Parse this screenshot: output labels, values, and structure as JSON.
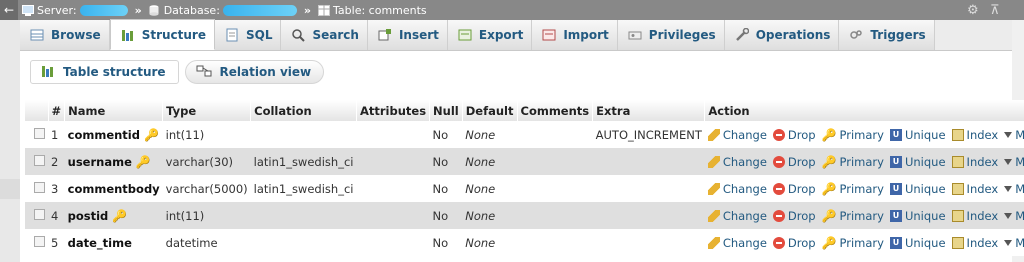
{
  "breadcrumb": {
    "server_label": "Server:",
    "database_label": "Database:",
    "table_label": "Table: comments"
  },
  "tabs": [
    {
      "label": "Browse",
      "icon": "browse-icon",
      "active": false
    },
    {
      "label": "Structure",
      "icon": "structure-icon",
      "active": true
    },
    {
      "label": "SQL",
      "icon": "sql-icon",
      "active": false
    },
    {
      "label": "Search",
      "icon": "search-icon",
      "active": false
    },
    {
      "label": "Insert",
      "icon": "insert-icon",
      "active": false
    },
    {
      "label": "Export",
      "icon": "export-icon",
      "active": false
    },
    {
      "label": "Import",
      "icon": "import-icon",
      "active": false
    },
    {
      "label": "Privileges",
      "icon": "privileges-icon",
      "active": false
    },
    {
      "label": "Operations",
      "icon": "operations-icon",
      "active": false
    },
    {
      "label": "Triggers",
      "icon": "triggers-icon",
      "active": false
    }
  ],
  "subnav": {
    "table_structure": "Table structure",
    "relation_view": "Relation view"
  },
  "columns": [
    "#",
    "Name",
    "Type",
    "Collation",
    "Attributes",
    "Null",
    "Default",
    "Comments",
    "Extra",
    "Action"
  ],
  "rows": [
    {
      "num": "1",
      "name": "commentid",
      "key": "primary",
      "type": "int(11)",
      "collation": "",
      "attributes": "",
      "null": "No",
      "default": "None",
      "comments": "",
      "extra": "AUTO_INCREMENT"
    },
    {
      "num": "2",
      "name": "username",
      "key": "index",
      "type": "varchar(30)",
      "collation": "latin1_swedish_ci",
      "attributes": "",
      "null": "No",
      "default": "None",
      "comments": "",
      "extra": ""
    },
    {
      "num": "3",
      "name": "commentbody",
      "key": "",
      "type": "varchar(5000)",
      "collation": "latin1_swedish_ci",
      "attributes": "",
      "null": "No",
      "default": "None",
      "comments": "",
      "extra": ""
    },
    {
      "num": "4",
      "name": "postid",
      "key": "index",
      "type": "int(11)",
      "collation": "",
      "attributes": "",
      "null": "No",
      "default": "None",
      "comments": "",
      "extra": ""
    },
    {
      "num": "5",
      "name": "date_time",
      "key": "",
      "type": "datetime",
      "collation": "",
      "attributes": "",
      "null": "No",
      "default": "None",
      "comments": "",
      "extra": ""
    }
  ],
  "actions": {
    "change": "Change",
    "drop": "Drop",
    "primary": "Primary",
    "unique": "Unique",
    "index": "Index",
    "more": "More"
  },
  "colors": {
    "link": "#235a81",
    "topbar": "#888888",
    "row_alt": "#dfdfdf",
    "redacted": "#39b3ee"
  }
}
